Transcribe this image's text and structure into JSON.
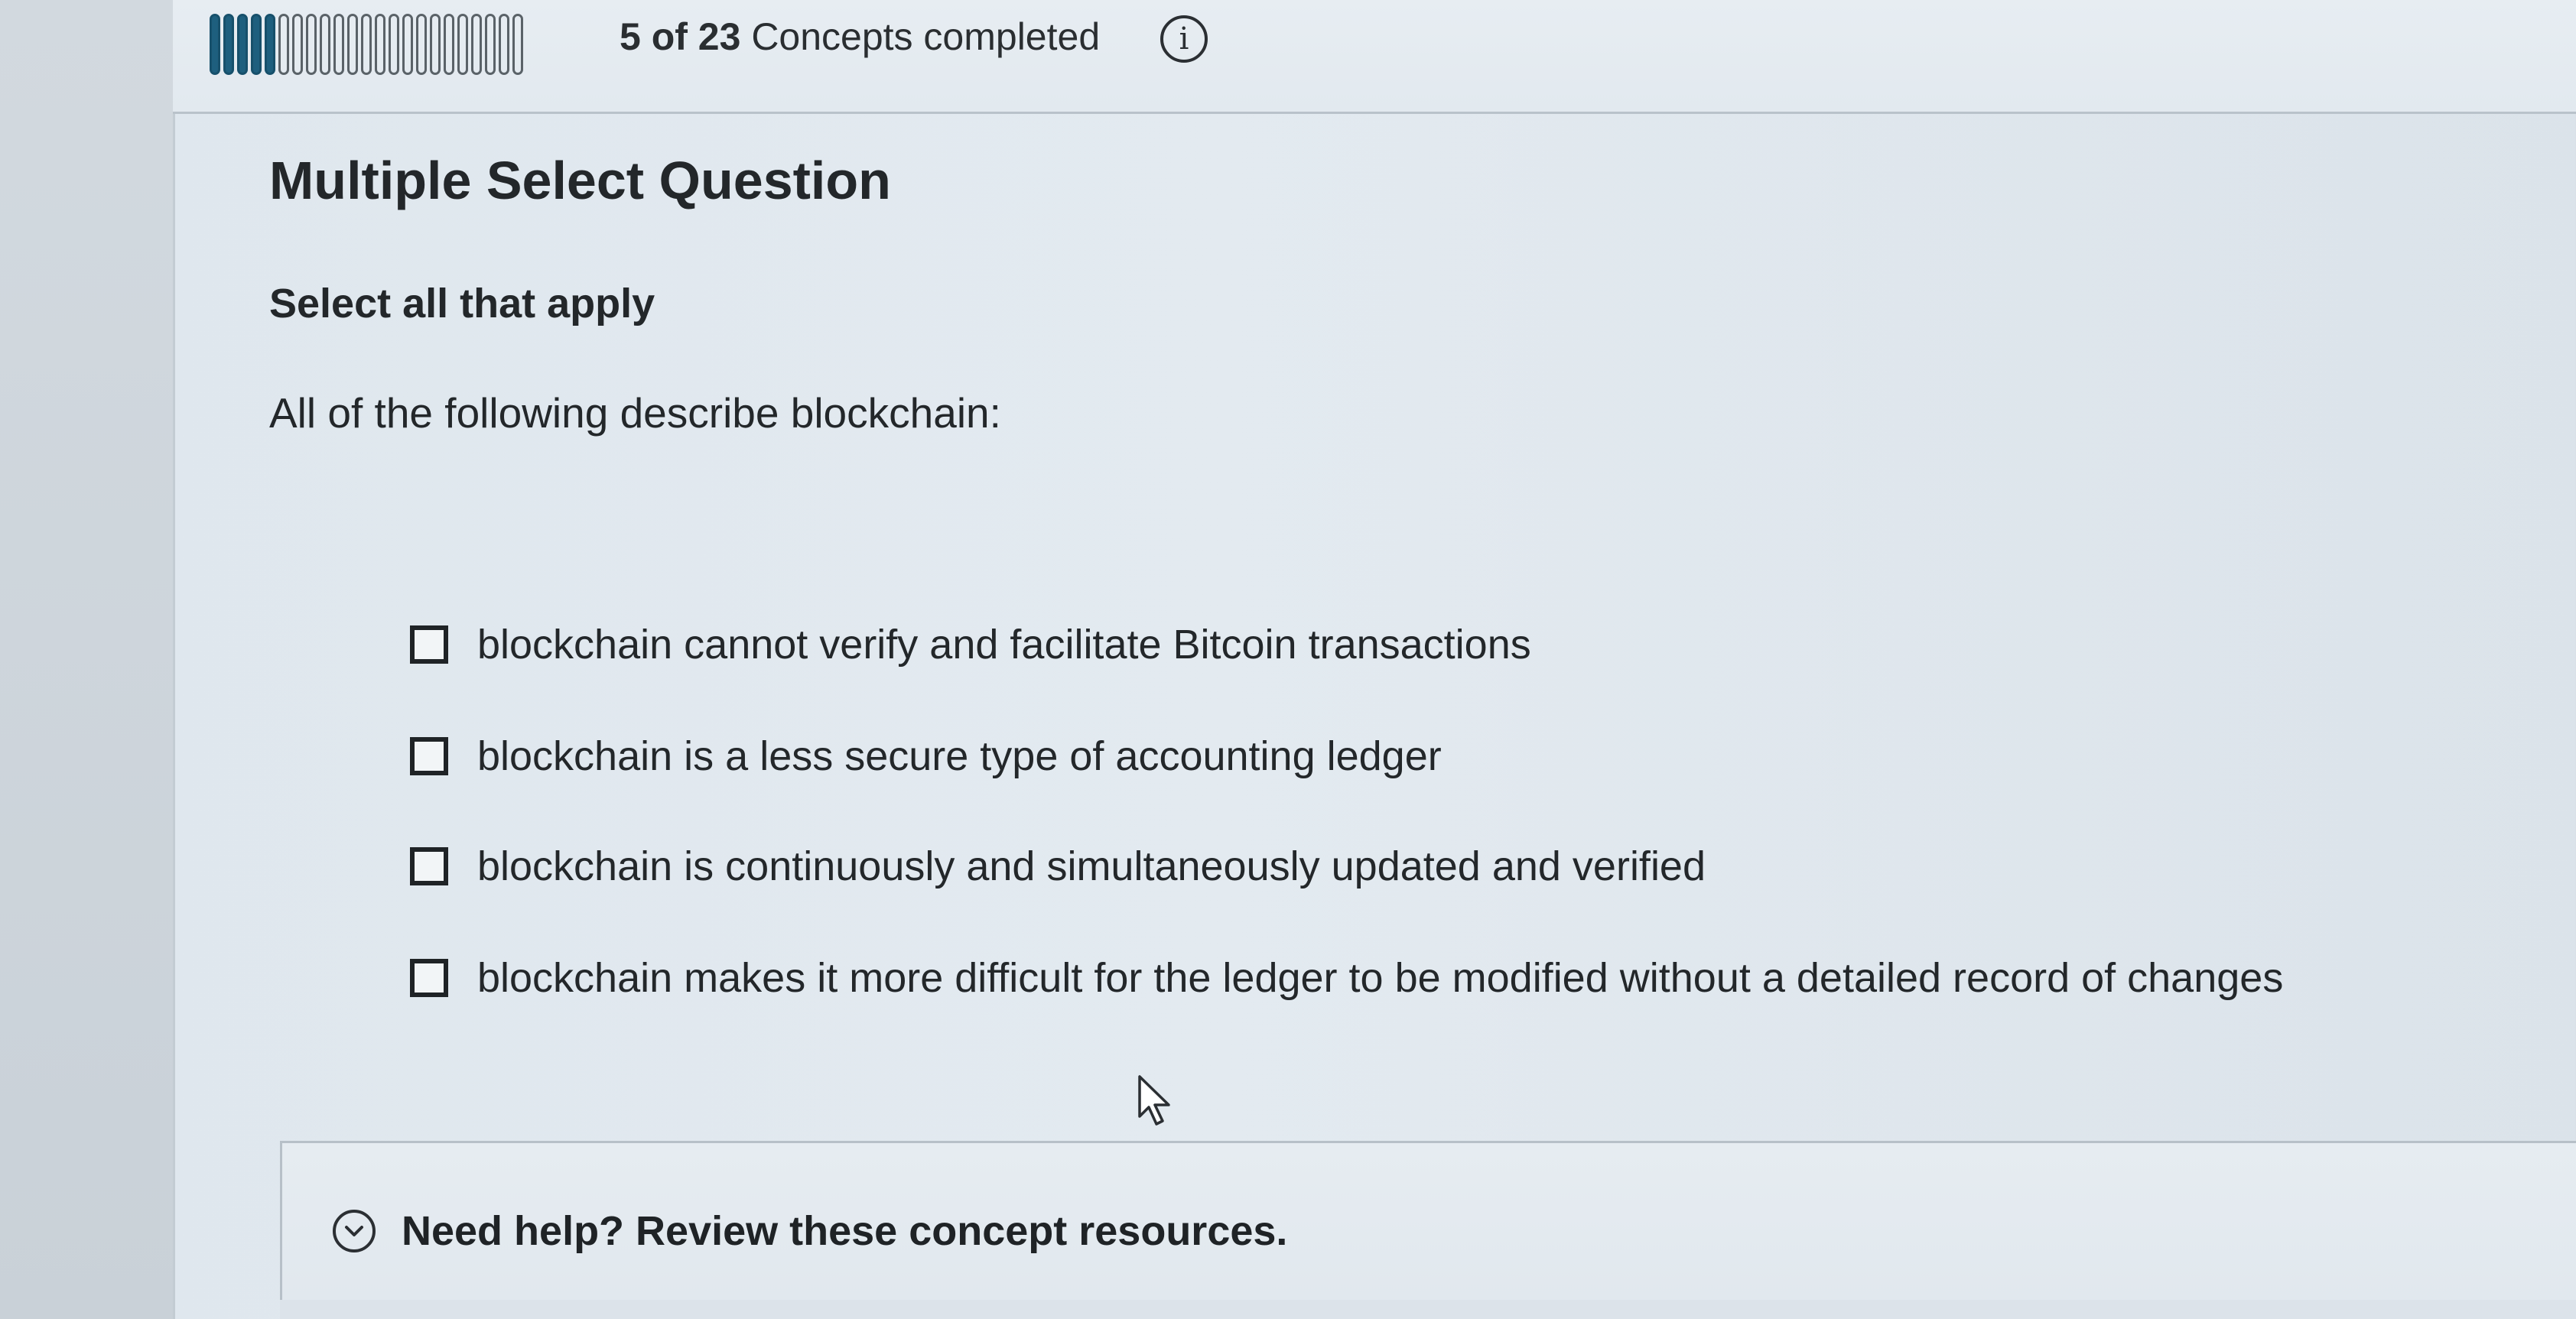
{
  "progress": {
    "completed": 5,
    "total": 23,
    "completed_text": "5 of 23",
    "suffix_text": "Concepts completed",
    "filled_colour": "#1e5f7e"
  },
  "header": {
    "info_icon": "info-icon",
    "info_glyph": "i"
  },
  "question": {
    "type_label": "Multiple Select Question",
    "instruction": "Select all that apply",
    "prompt": "All of the following describe blockchain:",
    "options": [
      {
        "label": "blockchain cannot verify and facilitate Bitcoin transactions",
        "checked": false
      },
      {
        "label": "blockchain is a less secure type of accounting ledger",
        "checked": false
      },
      {
        "label": "blockchain is continuously and simultaneously updated and verified",
        "checked": false
      },
      {
        "label": "blockchain makes it more difficult for the ledger to be modified without a detailed record of changes",
        "checked": false
      }
    ]
  },
  "help": {
    "icon": "chevron-down-icon",
    "label": "Need help? Review these concept resources."
  },
  "pointer": {
    "icon": "mouse-cursor-icon"
  }
}
